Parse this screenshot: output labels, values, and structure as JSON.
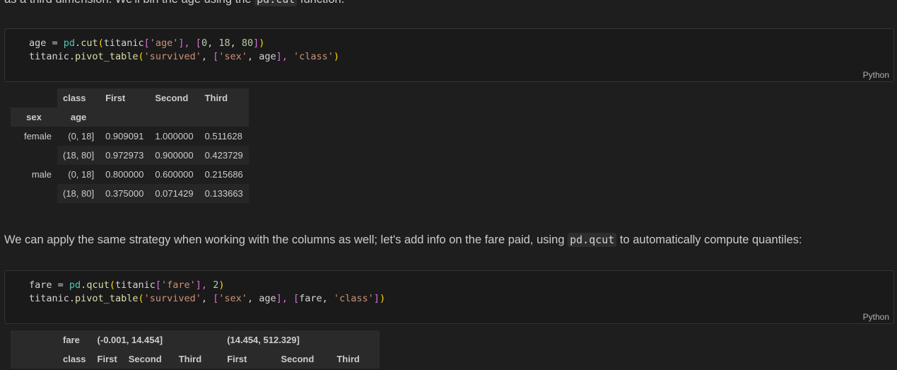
{
  "intro_line": {
    "before": "as a third dimension. We'll bin the age using the ",
    "code": "pd.cut",
    "after": " function."
  },
  "cell1": {
    "line1": {
      "a": "age",
      "b": " = ",
      "c": "pd",
      "d": ".",
      "e": "cut",
      "f": "(",
      "g": "titanic",
      "h": "[",
      "i": "'age'",
      "j": "], ",
      "k": "[",
      "l": "0",
      "m": ", ",
      "n": "18",
      "o": ", ",
      "p": "80",
      "q": "]",
      "r": ")"
    },
    "line2": {
      "a": "titanic",
      "b": ".",
      "c": "pivot_table",
      "d": "(",
      "e": "'survived'",
      "f": ", ",
      "g": "[",
      "h": "'sex'",
      "i": ", ",
      "j": "age",
      "k": "], ",
      "l": "'class'",
      "m": ")"
    },
    "lang": "Python"
  },
  "table1": {
    "col_index_name": "class",
    "columns": [
      "First",
      "Second",
      "Third"
    ],
    "row_index_names": [
      "sex",
      "age"
    ],
    "rows": [
      {
        "sex": "female",
        "age": "(0, 18]",
        "values": [
          "0.909091",
          "1.000000",
          "0.511628"
        ]
      },
      {
        "sex": "",
        "age": "(18, 80]",
        "values": [
          "0.972973",
          "0.900000",
          "0.423729"
        ]
      },
      {
        "sex": "male",
        "age": "(0, 18]",
        "values": [
          "0.800000",
          "0.600000",
          "0.215686"
        ]
      },
      {
        "sex": "",
        "age": "(18, 80]",
        "values": [
          "0.375000",
          "0.071429",
          "0.133663"
        ]
      }
    ]
  },
  "paragraph2": {
    "before": "We can apply the same strategy when working with the columns as well; let's add info on the fare paid, using ",
    "code": "pd.qcut",
    "after": " to automatically compute quantiles:"
  },
  "cell2": {
    "line1": {
      "a": "fare",
      "b": " = ",
      "c": "pd",
      "d": ".",
      "e": "qcut",
      "f": "(",
      "g": "titanic",
      "h": "[",
      "i": "'fare'",
      "j": "], ",
      "k": "2",
      "l": ")"
    },
    "line2": {
      "a": "titanic",
      "b": ".",
      "c": "pivot_table",
      "d": "(",
      "e": "'survived'",
      "f": ", ",
      "g": "[",
      "h": "'sex'",
      "i": ", ",
      "j": "age",
      "k": "], ",
      "l": "[",
      "m": "fare",
      "n": ", ",
      "o": "'class'",
      "p": "]",
      "q": ")"
    },
    "lang": "Python"
  },
  "table2": {
    "level0_name": "fare",
    "level0": [
      "(-0.001, 14.454]",
      "(14.454, 512.329]"
    ],
    "level1_name": "class",
    "level1": [
      "First",
      "Second",
      "Third",
      "First",
      "Second",
      "Third"
    ]
  }
}
